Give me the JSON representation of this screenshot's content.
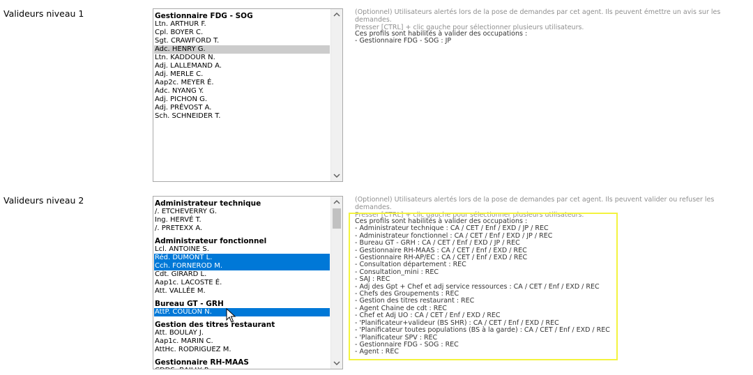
{
  "validators_level1": {
    "label": "Valideurs niveau 1",
    "help_line1": "(Optionnel) Utilisateurs alertés lors de la pose de demandes par cet agent. Ils peuvent émettre un avis sur les demandes.",
    "help_line2": "Presser [CTRL] + clic gauche pour sélectionner plusieurs utilisateurs.",
    "profiles_title": "Ces profils sont habilités à valider des occupations :",
    "profiles": [
      "- Gestionnaire FDG - SOG : JP"
    ],
    "groups": [
      {
        "name": "Gestionnaire FDG - SOG",
        "options": [
          {
            "text": "Ltn. ARTHUR F.",
            "state": "normal"
          },
          {
            "text": "Cpl. BOYER C.",
            "state": "normal"
          },
          {
            "text": "Sgt. CRAWFORD T.",
            "state": "normal"
          },
          {
            "text": "Adc. HENRY G.",
            "state": "highlighted"
          },
          {
            "text": "Ltn. KADDOUR N.",
            "state": "normal"
          },
          {
            "text": "Adj. LALLEMAND A.",
            "state": "normal"
          },
          {
            "text": "Adj. MERLE C.",
            "state": "normal"
          },
          {
            "text": "Aap2c. MEYER É.",
            "state": "normal"
          },
          {
            "text": "Adc. NYANG Y.",
            "state": "normal"
          },
          {
            "text": "Adj. PICHON G.",
            "state": "normal"
          },
          {
            "text": "Adj. PRÉVOST A.",
            "state": "normal"
          },
          {
            "text": "Sch. SCHNEIDER T.",
            "state": "normal"
          }
        ]
      }
    ]
  },
  "validators_level2": {
    "label": "Valideurs niveau 2",
    "help_line1": "(Optionnel) Utilisateurs alertés lors de la pose de demandes par cet agent. Ils peuvent valider ou refuser les demandes.",
    "help_line2": "Presser [CTRL] + clic gauche pour sélectionner plusieurs utilisateurs.",
    "profiles_title": "Ces profils sont habilités à valider des occupations :",
    "profiles": [
      "- Administrateur technique : CA / CET / Enf / EXD / JP / REC",
      "- Administrateur fonctionnel : CA / CET / Enf / EXD / JP / REC",
      "- Bureau GT - GRH : CA / CET / Enf / EXD / JP / REC",
      "- Gestionnaire RH-MAAS : CA / CET / Enf / EXD / REC",
      "- Gestionnaire RH-AP/EC : CA / CET / Enf / EXD / REC",
      "- Consultation département : REC",
      "- Consultation_mini : REC",
      "- SAJ : REC",
      "- Adj des Gpt + Chef et adj service ressources : CA / CET / Enf / EXD / REC",
      "- Chefs des Groupements : REC",
      "- Gestion des titres restaurant : REC",
      "- Agent Chaine de cdt : REC",
      "- Chef et Adj UO : CA / CET / Enf / EXD / REC",
      "- 'Planificateur+valideur (BS SHR) : CA / CET / Enf / EXD / REC",
      "- 'Planificateur toutes populations (BS à la garde) : CA / CET / Enf / EXD / REC",
      "- 'Planificateur SPV : REC",
      "- Gestionnaire FDG - SOG : REC",
      "- Agent : REC"
    ],
    "groups": [
      {
        "name": "Administrateur technique",
        "options": [
          {
            "text": "/. ETCHEVERRY G.",
            "state": "normal"
          },
          {
            "text": "Ing. HERVÉ T.",
            "state": "normal"
          },
          {
            "text": "/. PRETEXX A.",
            "state": "normal"
          }
        ]
      },
      {
        "name": "Administrateur fonctionnel",
        "options": [
          {
            "text": "Lcl. ANTOINE S.",
            "state": "normal"
          },
          {
            "text": "Réd. DUMONT L.",
            "state": "selected"
          },
          {
            "text": "Cch. FORNEROD M.",
            "state": "selected"
          },
          {
            "text": "Cdt. GIRARD L.",
            "state": "normal"
          },
          {
            "text": "Aap1c. LACOSTE É.",
            "state": "normal"
          },
          {
            "text": "Att. VALLÉE M.",
            "state": "normal"
          }
        ]
      },
      {
        "name": "Bureau GT - GRH",
        "options": [
          {
            "text": "AttP. COULON N.",
            "state": "selected"
          }
        ]
      },
      {
        "name": "Gestion des titres restaurant",
        "options": [
          {
            "text": "Att. BOULAY J.",
            "state": "normal"
          },
          {
            "text": "Aap1c. MARIN C.",
            "state": "normal"
          },
          {
            "text": "AttHc. RODRIGUEZ M.",
            "state": "normal"
          }
        ]
      },
      {
        "name": "Gestionnaire RH-MAAS",
        "options": [
          {
            "text": "CDDS. BAILLY P.",
            "state": "normal"
          }
        ]
      }
    ]
  }
}
